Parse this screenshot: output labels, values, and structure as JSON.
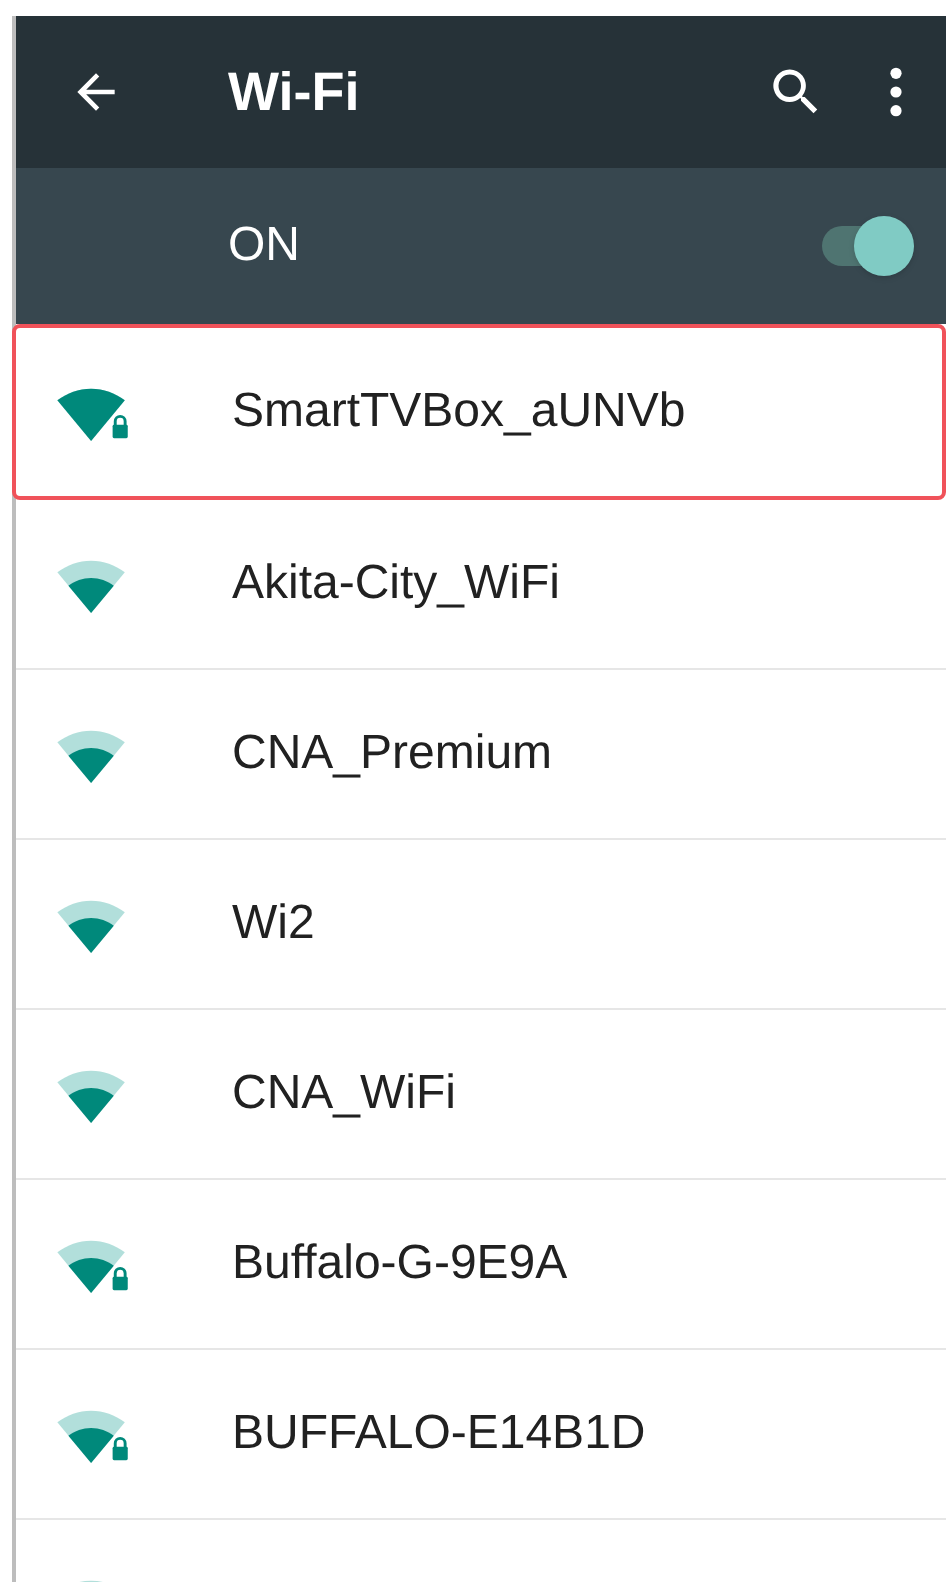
{
  "toolbar": {
    "title": "Wi-Fi"
  },
  "master_switch": {
    "label": "ON",
    "on": true
  },
  "networks": [
    {
      "name": "SmartTVBox_aUNVb",
      "kind": "full",
      "secured": true,
      "selected": true
    },
    {
      "name": "Akita-City_WiFi",
      "kind": "medium",
      "secured": false,
      "selected": false
    },
    {
      "name": "CNA_Premium",
      "kind": "medium",
      "secured": false,
      "selected": false
    },
    {
      "name": "Wi2",
      "kind": "medium",
      "secured": false,
      "selected": false
    },
    {
      "name": "CNA_WiFi",
      "kind": "medium",
      "secured": false,
      "selected": false
    },
    {
      "name": "Buffalo-G-9E9A",
      "kind": "medium",
      "secured": true,
      "selected": false
    },
    {
      "name": "BUFFALO-E14B1D",
      "kind": "medium",
      "secured": true,
      "selected": false
    },
    {
      "kind": "medium",
      "selected": false
    }
  ]
}
